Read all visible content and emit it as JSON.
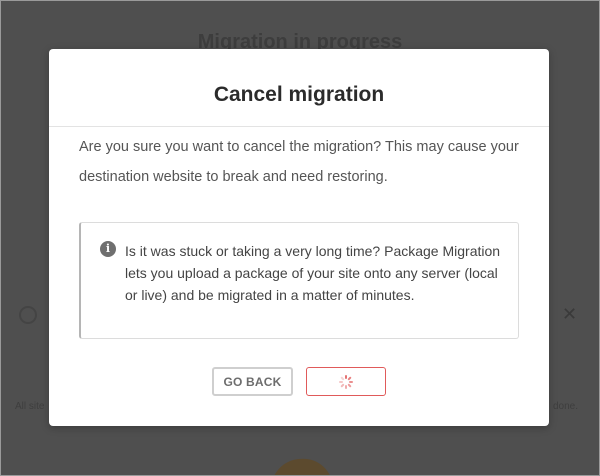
{
  "background": {
    "title": "Migration in progress",
    "left_text": "All site",
    "right_text": "done."
  },
  "modal": {
    "title": "Cancel migration",
    "message": "Are you sure you want to cancel the migration? This may cause your destination website to break and need restoring.",
    "info": {
      "icon": "info-icon",
      "text": "Is it was stuck or taking a very long time? Package Migration lets you upload a package of your site onto any server (local or live) and be migrated in a matter of minutes."
    },
    "buttons": {
      "back_label": "GO BACK",
      "confirm_state": "loading"
    }
  },
  "colors": {
    "overlay": "#4f4f4f",
    "modal_bg": "#ffffff",
    "danger": "#e05a5a"
  }
}
